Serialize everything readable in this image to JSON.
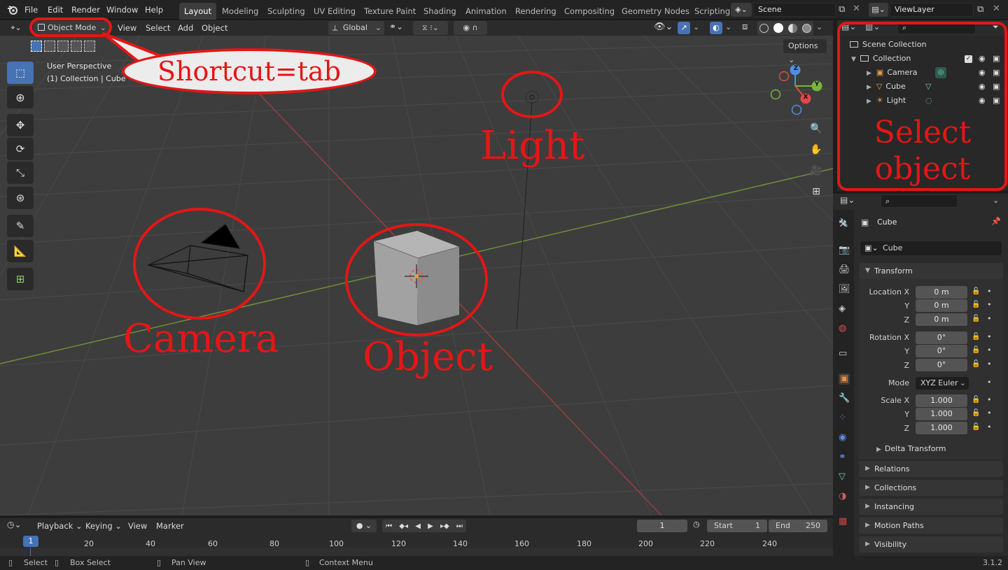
{
  "topbar": {
    "menus": [
      "File",
      "Edit",
      "Render",
      "Window",
      "Help"
    ],
    "workspaces": [
      "Layout",
      "Modeling",
      "Sculpting",
      "UV Editing",
      "Texture Paint",
      "Shading",
      "Animation",
      "Rendering",
      "Compositing",
      "Geometry Nodes",
      "Scripting"
    ],
    "active_workspace": "Layout",
    "scene": "Scene",
    "view_layer": "ViewLayer"
  },
  "viewport_header": {
    "mode": "Object Mode",
    "menus": [
      "View",
      "Select",
      "Add",
      "Object"
    ],
    "orientation": "Global",
    "options_label": "Options"
  },
  "viewport": {
    "perspective": "User Perspective",
    "collection_info": "(1) Collection | Cube",
    "gizmo_axes": [
      "Z",
      "Y",
      "X"
    ]
  },
  "annotations": {
    "shortcut": "Shortcut=tab",
    "light": "Light",
    "camera": "Camera",
    "object": "Object",
    "select_line1": "Select",
    "select_line2": "object",
    "color": "#e41616"
  },
  "outliner": {
    "root": "Scene Collection",
    "collection": "Collection",
    "items": [
      "Camera",
      "Cube",
      "Light"
    ]
  },
  "properties": {
    "object_name": "Cube",
    "datablock": "Cube",
    "transform_title": "Transform",
    "location_label": "Location X",
    "rotation_label": "Rotation X",
    "scale_label": "Scale X",
    "axis_y": "Y",
    "axis_z": "Z",
    "location": [
      "0 m",
      "0 m",
      "0 m"
    ],
    "rotation": [
      "0°",
      "0°",
      "0°"
    ],
    "mode_label": "Mode",
    "mode_value": "XYZ Euler",
    "scale": [
      "1.000",
      "1.000",
      "1.000"
    ],
    "delta_transform": "Delta Transform",
    "panels": [
      "Relations",
      "Collections",
      "Instancing",
      "Motion Paths",
      "Visibility"
    ]
  },
  "timeline": {
    "menus": [
      "Playback",
      "Keying",
      "View",
      "Marker"
    ],
    "current_frame": "1",
    "start_label": "Start",
    "start": "1",
    "end_label": "End",
    "end": "250",
    "frame_marker": "1",
    "ticks": [
      "20",
      "40",
      "60",
      "80",
      "100",
      "120",
      "140",
      "160",
      "180",
      "200",
      "220",
      "240"
    ]
  },
  "status": {
    "select": "Select",
    "box_select": "Box Select",
    "pan_view": "Pan View",
    "context_menu": "Context Menu",
    "version": "3.1.2"
  },
  "colors": {
    "accent": "#4772b3",
    "x_axis": "#e04848",
    "y_axis": "#7ab53a",
    "z_axis": "#4d8fe6"
  }
}
